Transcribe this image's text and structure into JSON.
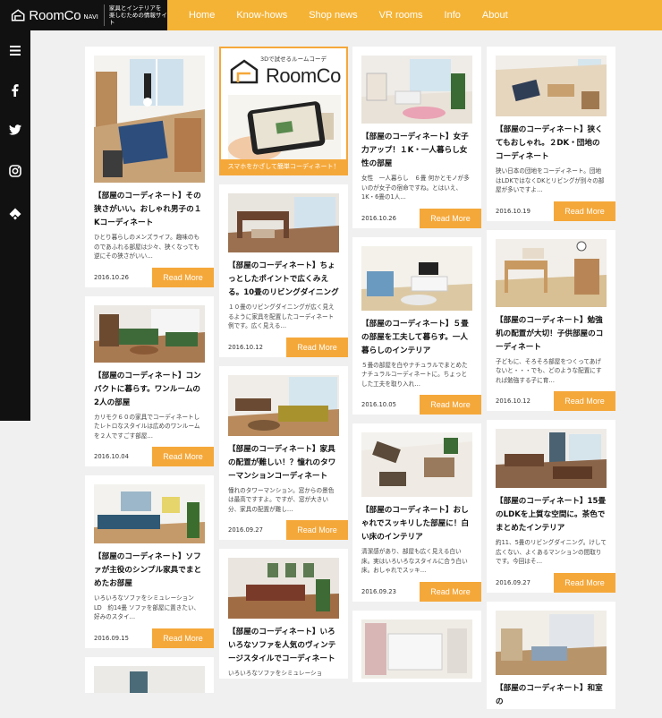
{
  "header": {
    "brand": "RoomCo",
    "brand_sub": "NAVI",
    "tagline_1": "家具とインテリアを",
    "tagline_2": "楽しむための情報サイト",
    "nav": [
      "Home",
      "Know-hows",
      "Shop news",
      "VR rooms",
      "Info",
      "About"
    ]
  },
  "sidebar": {
    "icons": [
      "menu-icon",
      "facebook-icon",
      "twitter-icon",
      "instagram-icon",
      "feedly-icon"
    ]
  },
  "ad": {
    "tag": "3Dで試せるルームコーデ",
    "logo": "RoomCo",
    "banner": "スマホをかざして簡単コーディネート！"
  },
  "more_label": "Read More",
  "columns": [
    [
      {
        "title": "【部屋のコーディネート】その狭さがいい。おしゃれ男子の１Kコーディネート",
        "excerpt": "ひとり暮らしのメンズライフ。趣味のものであふれる部屋は少々、狭くなっても逆にその狭さがいい…",
        "date": "2016.10.26"
      },
      {
        "title": "【部屋のコーディネート】コンパクトに暮らす。ワンルームの2人の部屋",
        "excerpt": "カリモク６０の家具でコーディネートしたレトロなスタイルは広めのワンルームを２人ですごす部屋…",
        "date": "2016.10.04"
      },
      {
        "title": "【部屋のコーディネート】ソファが主役のシンプル家具でまとめたお部屋",
        "excerpt": "いろいろなソファをシミュレーション　LD　約14畳 ソファを部屋に置きたい、好みのスタイ…",
        "date": "2016.09.15"
      }
    ],
    [
      {
        "title": "【部屋のコーディネート】ちょっとしたポイントで広くみえる。10畳のリビングダイニング",
        "excerpt": "１０畳のリビングダイニングが広く見えるように家具を配置したコーディネート例です。広く見える…",
        "date": "2016.10.12"
      },
      {
        "title": "【部屋のコーディネート】家具の配置が難しい！？憧れのタワーマンションコーディネート",
        "excerpt": "憧れのタワーマンション。窓からの景色は最高ですすよ。ですが、窓が大きい分、家具の配置が難し…",
        "date": "2016.09.27"
      },
      {
        "title": "【部屋のコーディネート】いろいろなソファを人気のヴィンテージスタイルでコーディネート",
        "excerpt": "いろいろなソファをシミュレーショ",
        "date": ""
      }
    ],
    [
      {
        "title": "【部屋のコーディネート】女子力アップ！１K・一人暮らし女性の部屋",
        "excerpt": "女性　一人暮らし　６畳 何かとモノが多いのが女子の宿命ですね。とはいえ、1K・6畳の1人…",
        "date": "2016.10.26"
      },
      {
        "title": "【部屋のコーディネート】５畳の部屋を工夫して暮らす。一人暮らしのインテリア",
        "excerpt": "５畳の部屋を白やナチュラルでまとめたナチュラルコーディネートに。ちょっとした工夫を取り入れ…",
        "date": "2016.10.05"
      },
      {
        "title": "【部屋のコーディネート】おしゃれでスッキリした部屋に！白い床のインテリア",
        "excerpt": "清潔感があり、部屋も広く見える白い床。実はいろいろなスタイルに合う白い床。おしゃれでスッキ…",
        "date": "2016.09.23"
      }
    ],
    [
      {
        "title": "【部屋のコーディネート】狭くてもおしゃれ。２DK・団地のコーディネート",
        "excerpt": "狭い日本の団地をコーディネート。団地はLDKではなくDKとリビングが別々の部屋が多いですよ…",
        "date": "2016.10.19"
      },
      {
        "title": "【部屋のコーディネート】勉強机の配置が大切！子供部屋のコーディネート",
        "excerpt": "子どもに、そろそろ部屋をつくってあげないと・・・でも、どのような配置にすれば勉強する子に育…",
        "date": "2016.10.12"
      },
      {
        "title": "【部屋のコーディネート】15畳のLDKを上質な空間に。茶色でまとめたインテリア",
        "excerpt": "約11、5畳のリビングダイニング。けして広くない、よくあるマンションの間取りです。今回はそ…",
        "date": "2016.09.27"
      },
      {
        "title": "【部屋のコーディネート】和室の",
        "excerpt": "",
        "date": ""
      }
    ]
  ]
}
